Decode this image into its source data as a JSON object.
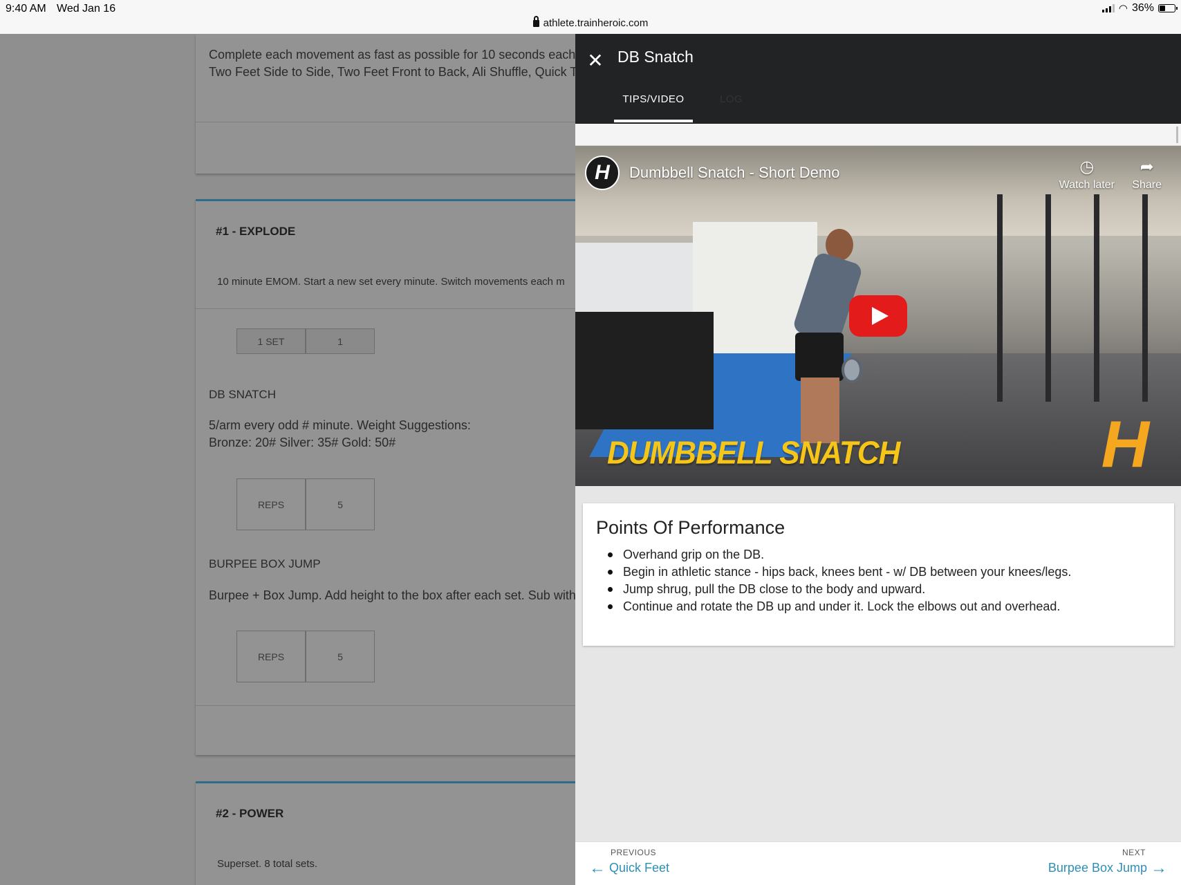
{
  "status_bar": {
    "time": "9:40 AM",
    "date": "Wed Jan 16",
    "url": "athlete.trainheroic.com",
    "battery": "36%"
  },
  "background": {
    "top_card": {
      "line1": "Complete each movement as fast as possible for 10 seconds each",
      "line2": "Two Feet Side to Side, Two Feet Front to Back, Ali Shuffle, Quick Te"
    },
    "explode": {
      "title": "#1 - EXPLODE",
      "description": "10 minute EMOM. Start a new set every minute. Switch movements each m",
      "set_label": "1 SET",
      "set_value": "1",
      "db_snatch": {
        "name": "DB SNATCH",
        "line1": "5/arm every odd # minute. Weight Suggestions:",
        "line2": "Bronze: 20# Silver: 35# Gold: 50#",
        "reps_label": "REPS",
        "reps_value": "5"
      },
      "burpee": {
        "name": "BURPEE BOX JUMP",
        "line1": "Burpee + Box Jump. Add height to the box after each set. Sub with",
        "reps_label": "REPS",
        "reps_value": "5"
      }
    },
    "power": {
      "title": "#2 - POWER",
      "description": "Superset. 8 total sets."
    }
  },
  "panel": {
    "close_glyph": "✕",
    "title": "DB Snatch",
    "tabs": [
      {
        "label": "TIPS/VIDEO",
        "active": true
      },
      {
        "label": "LOG",
        "active": false
      }
    ],
    "video": {
      "channel_logo": "H",
      "title": "Dumbbell Snatch - Short Demo",
      "watch_later": "Watch later",
      "share": "Share",
      "caption": "DUMBBELL SNATCH",
      "brand_mark": "H"
    },
    "points": {
      "heading": "Points Of Performance",
      "items": [
        "Overhand grip on the DB.",
        "Begin in athletic stance - hips back, knees bent - w/ DB between your knees/legs.",
        "Jump shrug, pull the DB close to the body and upward.",
        "Continue and rotate the DB up and under it. Lock the elbows out and overhead."
      ]
    },
    "nav": {
      "previous_label": "PREVIOUS",
      "previous_name": "Quick Feet",
      "next_label": "NEXT",
      "next_name": "Burpee Box Jump"
    }
  },
  "colors": {
    "accent": "#2e8fb5",
    "header_bg": "#212325",
    "section_border": "#2f6c89",
    "play_button": "#e31b1b",
    "caption_yellow": "#f5c518"
  }
}
